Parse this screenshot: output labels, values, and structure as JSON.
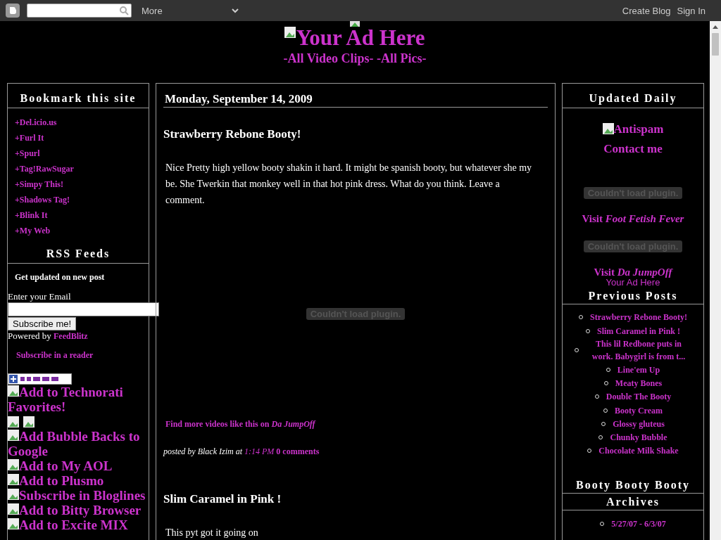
{
  "navbar": {
    "more": "More",
    "links": [
      "Create Blog",
      "Sign In"
    ]
  },
  "header": {
    "ad": "Your Ad Here",
    "subtitle": "-All Video Clips- -All Pics-"
  },
  "left": {
    "bookmark": {
      "title": "Bookmark this site",
      "links": [
        "+Del.icio.us",
        "+Furl It",
        "+Spurl",
        "+Tag!RawSugar",
        "+Simpy This!",
        "+Shadows Tag!",
        "+Blink It",
        "+My Web"
      ]
    },
    "rss": {
      "title": "RSS Feeds",
      "prompt": "Get updated on new post",
      "email_label": "Enter your Email",
      "button": "Subscribe me!",
      "powered_by": "Powered by",
      "powered_link": "FeedBlitz",
      "reader": "Subscribe in a reader",
      "feeds": [
        {
          "kind": "badge"
        },
        {
          "kind": "link",
          "text": "Add to Technorati Favorites!"
        },
        {
          "kind": "blank-pair"
        },
        {
          "kind": "link",
          "text": "Add Bubble Backs to Google"
        },
        {
          "kind": "link",
          "text": "Add to My AOL"
        },
        {
          "kind": "link",
          "text": "Add to Plusmo"
        },
        {
          "kind": "link",
          "text": "Subscribe in Bloglines"
        },
        {
          "kind": "link",
          "text": "Add to Bitty Browser"
        },
        {
          "kind": "link",
          "text": "Add to Excite MIX"
        }
      ]
    }
  },
  "main": {
    "date": "Monday, September 14, 2009",
    "posts": [
      {
        "title": "Strawberry Rebone Booty!",
        "body": "Nice Pretty high yellow booty shakin it hard. It might be spanish booty, but whatever she my be. She Twerkin that monkey well in that hot pink dress. What do you think. Leave a comment.",
        "plugin": "Couldn't load plugin.",
        "more": "Find more videos like this on *Da JumpOff*",
        "posted_by": "posted by Black Izim at",
        "time": "1:14 PM",
        "comments": "0 comments"
      },
      {
        "title": "Slim Caramel in Pink !",
        "body": "This pyt got it going on"
      }
    ]
  },
  "right": {
    "updated": {
      "title": "Updated Daily",
      "antispam": "Antispam",
      "contact": "Contact me",
      "widgets": [
        {
          "plugin": "Couldn't load plugin.",
          "visit": "Visit *Foot Fetish Fever*"
        },
        {
          "plugin": "Couldn't load plugin.",
          "visit": "Visit *Da JumpOff*"
        }
      ],
      "ad": "Your Ad Here"
    },
    "previous": {
      "title": "Previous Posts",
      "items": [
        "Strawberry Rebone Booty!",
        "Slim Caramel in Pink !",
        "This lil Redbone puts in work. Babygirl is from t...",
        "Line'em Up",
        "Meaty Bones",
        "Double The Booty",
        "Booty Cream",
        "Glossy gluteus",
        "Chunky Bubble",
        "Chocolate Milk Shake"
      ]
    },
    "booty": {
      "title": "Booty Booty Booty"
    },
    "archives": {
      "title": "Archives",
      "items": [
        "5/27/07 - 6/3/07"
      ]
    }
  }
}
